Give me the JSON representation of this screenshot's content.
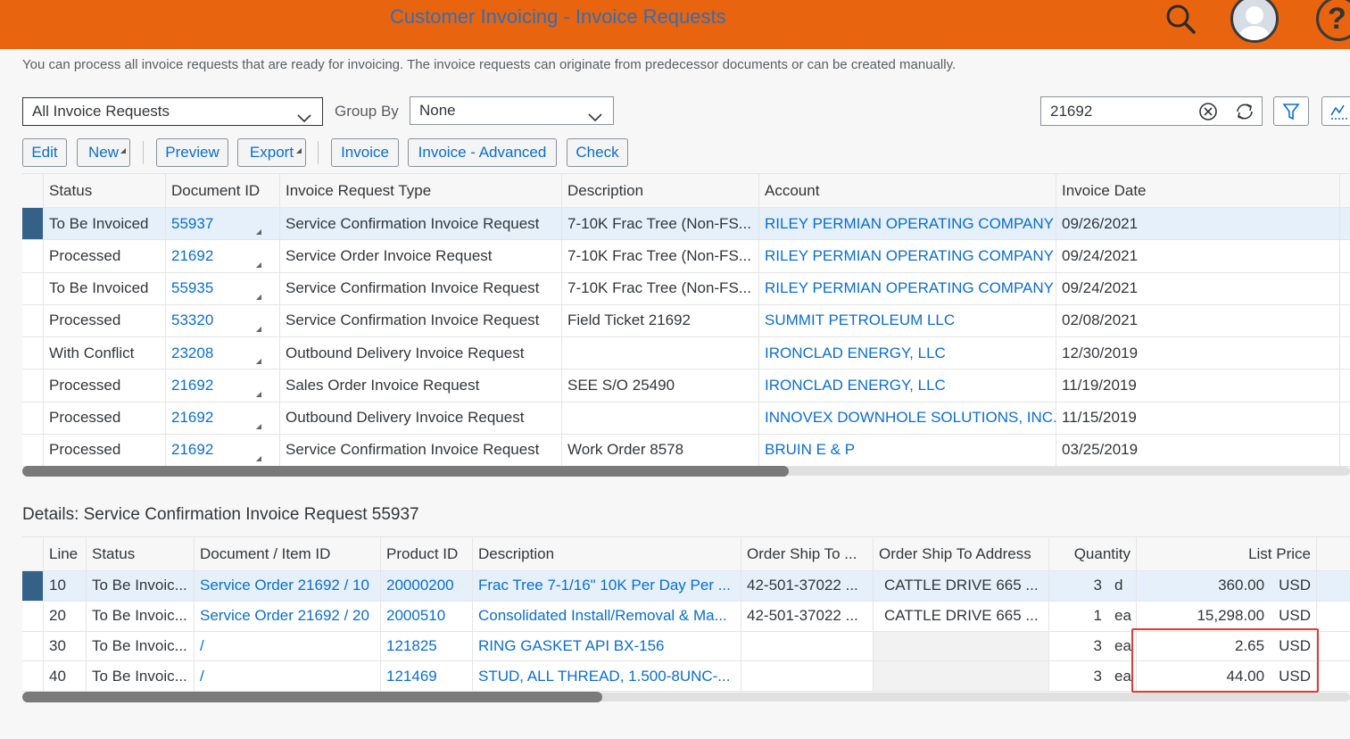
{
  "header": {
    "title": "Customer Invoicing - Invoice Requests"
  },
  "page": {
    "description": "You can process all invoice requests that are ready for invoicing. The invoice requests can originate from predecessor documents or can be created manually."
  },
  "filters": {
    "view_value": "All Invoice Requests",
    "group_by_label": "Group By",
    "group_by_value": "None",
    "search_value": "21692"
  },
  "toolbar": {
    "edit": "Edit",
    "new": "New",
    "preview": "Preview",
    "export": "Export",
    "invoice": "Invoice",
    "invoice_advanced": "Invoice - Advanced",
    "check": "Check"
  },
  "main_table": {
    "columns": [
      "Status",
      "Document ID",
      "Invoice Request Type",
      "Description",
      "Account",
      "Invoice Date"
    ],
    "rows": [
      {
        "status": "To Be Invoiced",
        "doc_id": "55937",
        "type": "Service Confirmation Invoice Request",
        "description": "7-10K Frac Tree (Non-FS...",
        "account": "RILEY PERMIAN OPERATING COMPANY",
        "date": "09/26/2021"
      },
      {
        "status": "Processed",
        "doc_id": "21692",
        "type": "Service Order Invoice Request",
        "description": "7-10K Frac Tree (Non-FS...",
        "account": "RILEY PERMIAN OPERATING COMPANY",
        "date": "09/24/2021"
      },
      {
        "status": "To Be Invoiced",
        "doc_id": "55935",
        "type": "Service Confirmation Invoice Request",
        "description": "7-10K Frac Tree (Non-FS...",
        "account": "RILEY PERMIAN OPERATING COMPANY",
        "date": "09/24/2021"
      },
      {
        "status": "Processed",
        "doc_id": "53320",
        "type": "Service Confirmation Invoice Request",
        "description": "Field Ticket 21692",
        "account": "SUMMIT PETROLEUM LLC",
        "date": "02/08/2021"
      },
      {
        "status": "With Conflict",
        "doc_id": "23208",
        "type": "Outbound Delivery Invoice Request",
        "description": "",
        "account": "IRONCLAD ENERGY, LLC",
        "date": "12/30/2019"
      },
      {
        "status": "Processed",
        "doc_id": "21692",
        "type": "Sales Order Invoice Request",
        "description": "SEE S/O 25490",
        "account": "IRONCLAD ENERGY, LLC",
        "date": "11/19/2019"
      },
      {
        "status": "Processed",
        "doc_id": "21692",
        "type": "Outbound Delivery Invoice Request",
        "description": "",
        "account": "INNOVEX DOWNHOLE SOLUTIONS, INC.",
        "date": "11/15/2019"
      },
      {
        "status": "Processed",
        "doc_id": "21692",
        "type": "Service Confirmation Invoice Request",
        "description": "Work Order 8578",
        "account": "BRUIN E & P",
        "date": "03/25/2019"
      }
    ]
  },
  "details": {
    "title": "Details: Service Confirmation Invoice Request 55937",
    "columns": [
      "Line",
      "Status",
      "Document / Item ID",
      "Product ID",
      "Description",
      "Order Ship To ...",
      "Order Ship To Address",
      "Quantity",
      "List Price"
    ],
    "rows": [
      {
        "line": "10",
        "status": "To Be Invoic...",
        "doc_item": "Service Order 21692 / 10",
        "product": "20000200",
        "description": "Frac Tree 7-1/16\" 10K Per Day Per ...",
        "ship_to": "42-501-37022 ...",
        "address": "CATTLE DRIVE 665 ...",
        "qty": "3",
        "unit": "d",
        "price": "360.00",
        "currency": "USD"
      },
      {
        "line": "20",
        "status": "To Be Invoic...",
        "doc_item": "Service Order 21692 / 20",
        "product": "2000510",
        "description": "Consolidated Install/Removal & Ma...",
        "ship_to": "42-501-37022 ...",
        "address": "CATTLE DRIVE 665 ...",
        "qty": "1",
        "unit": "ea",
        "price": "15,298.00",
        "currency": "USD"
      },
      {
        "line": "30",
        "status": "To Be Invoic...",
        "doc_item": "/",
        "product": "121825",
        "description": "RING GASKET API BX-156",
        "ship_to": "",
        "address": "",
        "qty": "3",
        "unit": "ea",
        "price": "2.65",
        "currency": "USD"
      },
      {
        "line": "40",
        "status": "To Be Invoic...",
        "doc_item": "/",
        "product": "121469",
        "description": "STUD, ALL THREAD, 1.500-8UNC-...",
        "ship_to": "",
        "address": "",
        "qty": "3",
        "unit": "ea",
        "price": "44.00",
        "currency": "USD"
      }
    ]
  },
  "icons": {
    "search": "search-icon",
    "avatar": "user-avatar-icon",
    "help": "help-icon",
    "clear": "clear-icon",
    "refresh": "refresh-icon",
    "filter": "filter-icon",
    "chart": "chart-icon",
    "chevron": "chevron-down-icon"
  },
  "colors": {
    "shell": "#e8640f",
    "link": "#0a6ed1",
    "selection": "#346187",
    "highlight": "#e53935"
  }
}
